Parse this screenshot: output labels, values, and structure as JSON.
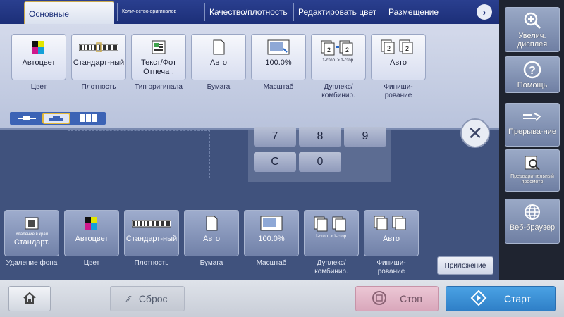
{
  "tabs": [
    {
      "label": "Основные"
    },
    {
      "label": "Количество оригиналов"
    },
    {
      "label": "Качество/плотность"
    },
    {
      "label": "Редактировать цвет"
    },
    {
      "label": "Размещение"
    }
  ],
  "right_panel": {
    "zoom": "Увелич. дисплея",
    "help": "Помощь",
    "interrupt": "Прерыва-ние",
    "preview": "Предвари-тельный просмотр",
    "browser": "Веб-браузер"
  },
  "settings": [
    {
      "value": "Автоцвет",
      "label": "Цвет"
    },
    {
      "value": "Стандарт-ный",
      "label": "Плотность"
    },
    {
      "value": "Текст/Фот Отпечат.",
      "label": "Тип оригинала"
    },
    {
      "value": "Авто",
      "label": "Бумага"
    },
    {
      "value": "100.0%",
      "label": "Масштаб"
    },
    {
      "value": "1-стор. > 1-стор.",
      "label": "Дуплекс/ комбинир."
    },
    {
      "value": "Авто",
      "label": "Финиши-рование"
    }
  ],
  "keypad": {
    "k7": "7",
    "k8": "8",
    "k9": "9",
    "clear": "C",
    "k0": "0"
  },
  "summary": [
    {
      "value": "Стандарт.",
      "sub": "Удаление в край",
      "label": "Удаление фона"
    },
    {
      "value": "Автоцвет",
      "label": "Цвет"
    },
    {
      "value": "Стандарт-ный",
      "label": "Плотность"
    },
    {
      "value": "Авто",
      "label": "Бумага"
    },
    {
      "value": "100.0%",
      "label": "Масштаб"
    },
    {
      "value": "1-стор. > 1-стор.",
      "label": "Дуплекс/ комбинир."
    },
    {
      "value": "Авто",
      "label": "Финиши-рование"
    }
  ],
  "app_button": "Приложение",
  "footer": {
    "reset": "Сброс",
    "stop": "Стоп",
    "start": "Старт"
  },
  "colors": {
    "accent": "#1c2f78",
    "start": "#3c8fd6",
    "stop": "#e6b8c9"
  }
}
